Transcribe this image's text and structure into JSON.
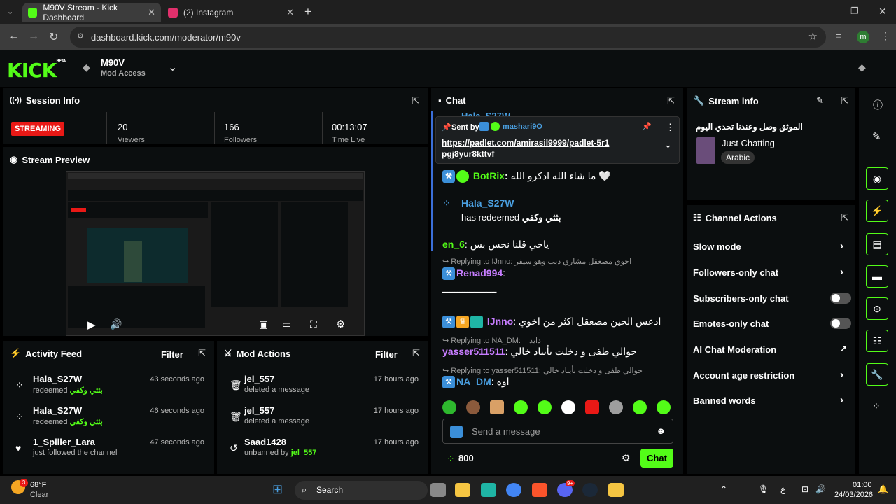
{
  "browser": {
    "tabs": [
      {
        "title": "M90V Stream - Kick Dashboard",
        "active": true
      },
      {
        "title": "(2) Instagram",
        "active": false
      }
    ],
    "url": "dashboard.kick.com/moderator/m90v",
    "new_tab": "+",
    "profile_initial": "m"
  },
  "header": {
    "logo": "KICK",
    "logo_badge": "BETA",
    "channel_name": "M90V",
    "access": "Mod Access"
  },
  "session_info": {
    "title": "Session Info",
    "status": "STREAMING",
    "viewers": "20",
    "viewers_label": "Viewers",
    "followers": "166",
    "followers_label": "Followers",
    "time_live": "00:13:07",
    "time_label": "Time Live"
  },
  "stream_preview": {
    "title": "Stream Preview"
  },
  "activity_feed": {
    "title": "Activity Feed",
    "filter": "Filter",
    "items": [
      {
        "name": "Hala_S27W",
        "action": "redeemed",
        "reward": "بثثي وكفي",
        "time": "43 seconds ago"
      },
      {
        "name": "Hala_S27W",
        "action": "redeemed",
        "reward": "بثثي وكفي",
        "time": "46 seconds ago"
      },
      {
        "name": "1_Spiller_Lara",
        "action": "just followed the channel",
        "reward": "",
        "time": "47 seconds ago"
      }
    ]
  },
  "mod_actions": {
    "title": "Mod Actions",
    "filter": "Filter",
    "items": [
      {
        "name": "jel_557",
        "action": "deleted a message",
        "by": "",
        "time": "17 hours ago"
      },
      {
        "name": "jel_557",
        "action": "deleted a message",
        "by": "",
        "time": "17 hours ago"
      },
      {
        "name": "Saad1428",
        "action": "unbanned by",
        "by": "jel_557",
        "time": "17 hours ago"
      }
    ]
  },
  "chat": {
    "title": "Chat",
    "partial_name": "Hala_S27W",
    "pinned": {
      "sent_by_label": "Sent by",
      "sender": "mashari9O",
      "link": "https://padlet.com/amirasil9999/padlet-5r1pgj8yur8kttvf"
    },
    "messages": [
      {
        "user": "BotRix",
        "text": "ما شاء الله اذكرو الله 🤍",
        "color": "#53fc18"
      },
      {
        "user": "Hala_S27W",
        "text": "has redeemed",
        "reward": "بثثي وكفي",
        "color": "#4a9fe0"
      },
      {
        "user": "en_6",
        "text": "ياخي قلنا نحس بس",
        "color": "#53fc18"
      },
      {
        "reply": "Replying to IJnno:",
        "reply_text": "اخوي مصعقل مشاري ذبب وهو سيفر",
        "user": "Renad994",
        "text": "ـ‍ـ‍ـ‍ـ‍ـ‍ـ‍ـ‍ـ‍ـ‍ـ‍ـ‍ـ‍ـ‍ـ‍ـ‍ـ‍ـ‍ـ‍ـ‍ـ‍ـ‍ـ",
        "color": "#c77dff"
      },
      {
        "user": "IJnno",
        "text": "ادعس الحين مصعقل اكثر من اخوي",
        "color": "#c77dff"
      },
      {
        "reply": "Replying to NA_DM:",
        "reply_text": "دايد ‏‏ ‏‏ ‏‏",
        "user": "yasser511511",
        "text": "جوالي طفى و دخلت بأيباد خالي",
        "color": "#c77dff"
      },
      {
        "reply": "Replying to yasser511511:",
        "reply_text": "جوالي طفى و دخلت بأيباد خالي",
        "user": "NA_DM",
        "text": "اوه",
        "color": "#4a9fe0"
      }
    ],
    "input_placeholder": "Send a message",
    "points": "800",
    "send": "Chat"
  },
  "stream_info": {
    "title": "Stream info",
    "stream_title": "الموثق وصل وعندنا تحدي اليوم",
    "category": "Just Chatting",
    "tag": "Arabic"
  },
  "channel_actions": {
    "title": "Channel Actions",
    "items": [
      {
        "label": "Slow mode",
        "kind": "chevron"
      },
      {
        "label": "Followers-only chat",
        "kind": "chevron"
      },
      {
        "label": "Subscribers-only chat",
        "kind": "toggle"
      },
      {
        "label": "Emotes-only chat",
        "kind": "toggle"
      },
      {
        "label": "AI Chat Moderation",
        "kind": "external"
      },
      {
        "label": "Account age restriction",
        "kind": "chevron"
      },
      {
        "label": "Banned words",
        "kind": "chevron"
      }
    ]
  },
  "taskbar": {
    "weather_temp": "68°F",
    "weather_desc": "Clear",
    "weather_badge": "3",
    "search": "Search",
    "time": "01:00",
    "date": "24/03/2026",
    "lang": "ع",
    "discord_badge": "9+"
  },
  "colors": {
    "accent": "#53fc18",
    "live": "#e91916",
    "panel": "#0b0e0f"
  }
}
